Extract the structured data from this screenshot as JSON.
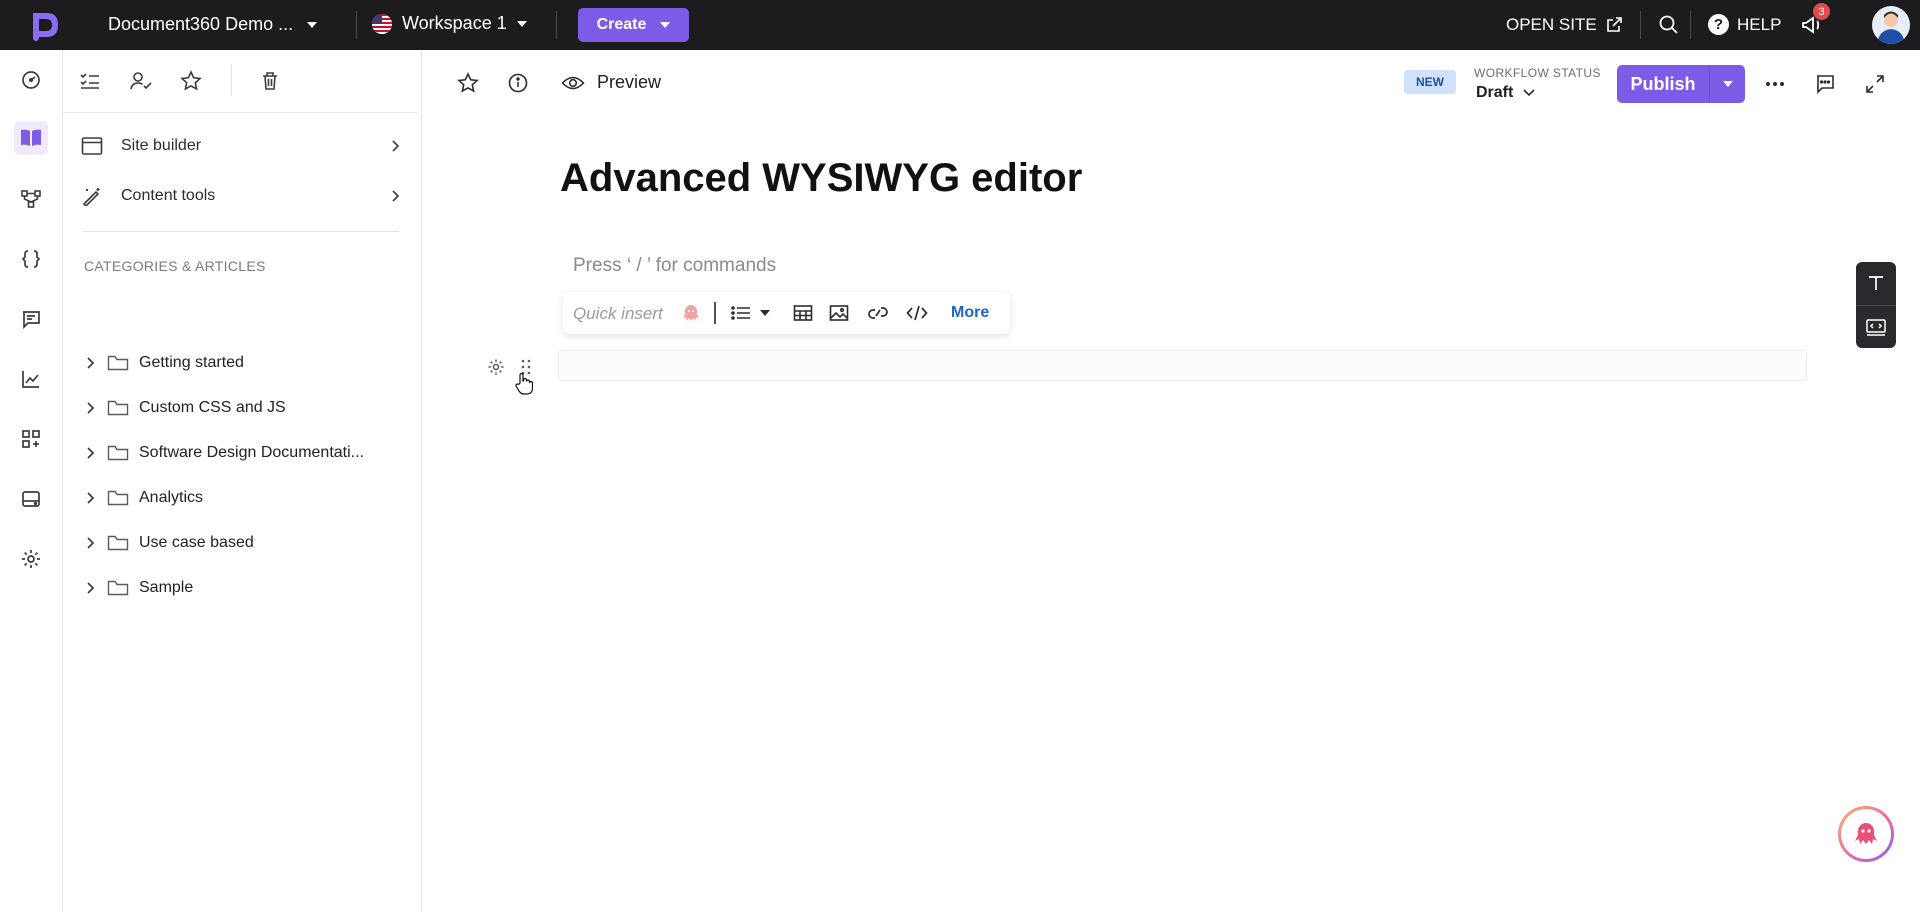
{
  "topbar": {
    "project_name": "Document360 Demo ...",
    "workspace": "Workspace 1",
    "create_label": "Create",
    "open_site_label": "OPEN SITE",
    "help_label": "HELP",
    "notification_count": "3",
    "brand_color": "#7c5ce6"
  },
  "rail": {
    "items": [
      "dashboard-icon",
      "documentation-icon",
      "api-diagram-icon",
      "code-braces-icon",
      "feedback-icon",
      "analytics-icon",
      "integrations-icon",
      "drive-icon",
      "settings-icon"
    ],
    "active": "documentation-icon"
  },
  "sidebar": {
    "menu": [
      {
        "label": "Site builder"
      },
      {
        "label": "Content tools"
      }
    ],
    "categories_heading": "CATEGORIES & ARTICLES",
    "categories": [
      {
        "name": "Getting started"
      },
      {
        "name": "Custom CSS and JS"
      },
      {
        "name": "Software Design Documentati..."
      },
      {
        "name": "Analytics"
      },
      {
        "name": "Use case based"
      },
      {
        "name": "Sample"
      }
    ]
  },
  "editor": {
    "preview_label": "Preview",
    "new_badge": "NEW",
    "workflow_status_label": "WORKFLOW STATUS",
    "workflow_status_value": "Draft",
    "publish_label": "Publish",
    "title": "Advanced WYSIWYG editor",
    "command_placeholder": "Press ‘ / ’ for commands",
    "quick_insert_label": "Quick insert",
    "more_label": "More"
  }
}
